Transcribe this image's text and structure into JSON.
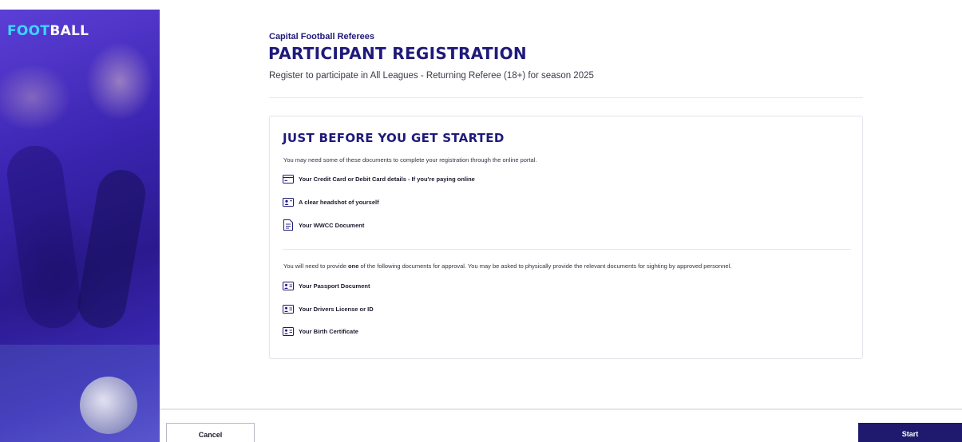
{
  "brand": {
    "logo_prefix": "FOOT",
    "logo_suffix": "BALL",
    "logo_colors": {
      "prefix": "#3fd4ff",
      "suffix": "#ffffff"
    }
  },
  "header": {
    "org_name": "Capital Football Referees",
    "title": "PARTICIPANT REGISTRATION",
    "subtitle": "Register to participate in All Leagues - Returning Referee (18+) for season 2025"
  },
  "card": {
    "title": "JUST BEFORE YOU GET STARTED",
    "intro": "You may need some of these documents to complete your registration through the online portal.",
    "documents": [
      {
        "icon": "credit-card-icon",
        "label": "Your Credit Card or Debit Card details - If you're paying online"
      },
      {
        "icon": "headshot-icon",
        "label": "A clear headshot of yourself"
      },
      {
        "icon": "document-icon",
        "label": "Your WWCC Document"
      }
    ],
    "approval_intro": {
      "before": "You will need to provide ",
      "emphasis": "one",
      "after": " of the following documents for approval.  You may be asked to physically provide the relevant documents for sighting by approved personnel."
    },
    "id_documents": [
      {
        "icon": "id-card-icon",
        "label": "Your Passport Document"
      },
      {
        "icon": "id-card-icon",
        "label": "Your Drivers License or ID"
      },
      {
        "icon": "id-card-icon",
        "label": "Your Birth Certificate"
      }
    ]
  },
  "footer": {
    "cancel_label": "Cancel",
    "start_label": "Start"
  },
  "colors": {
    "primary": "#1f1a7a",
    "start_button": "#1f1a6e",
    "brand_accent": "#3fd4ff"
  }
}
